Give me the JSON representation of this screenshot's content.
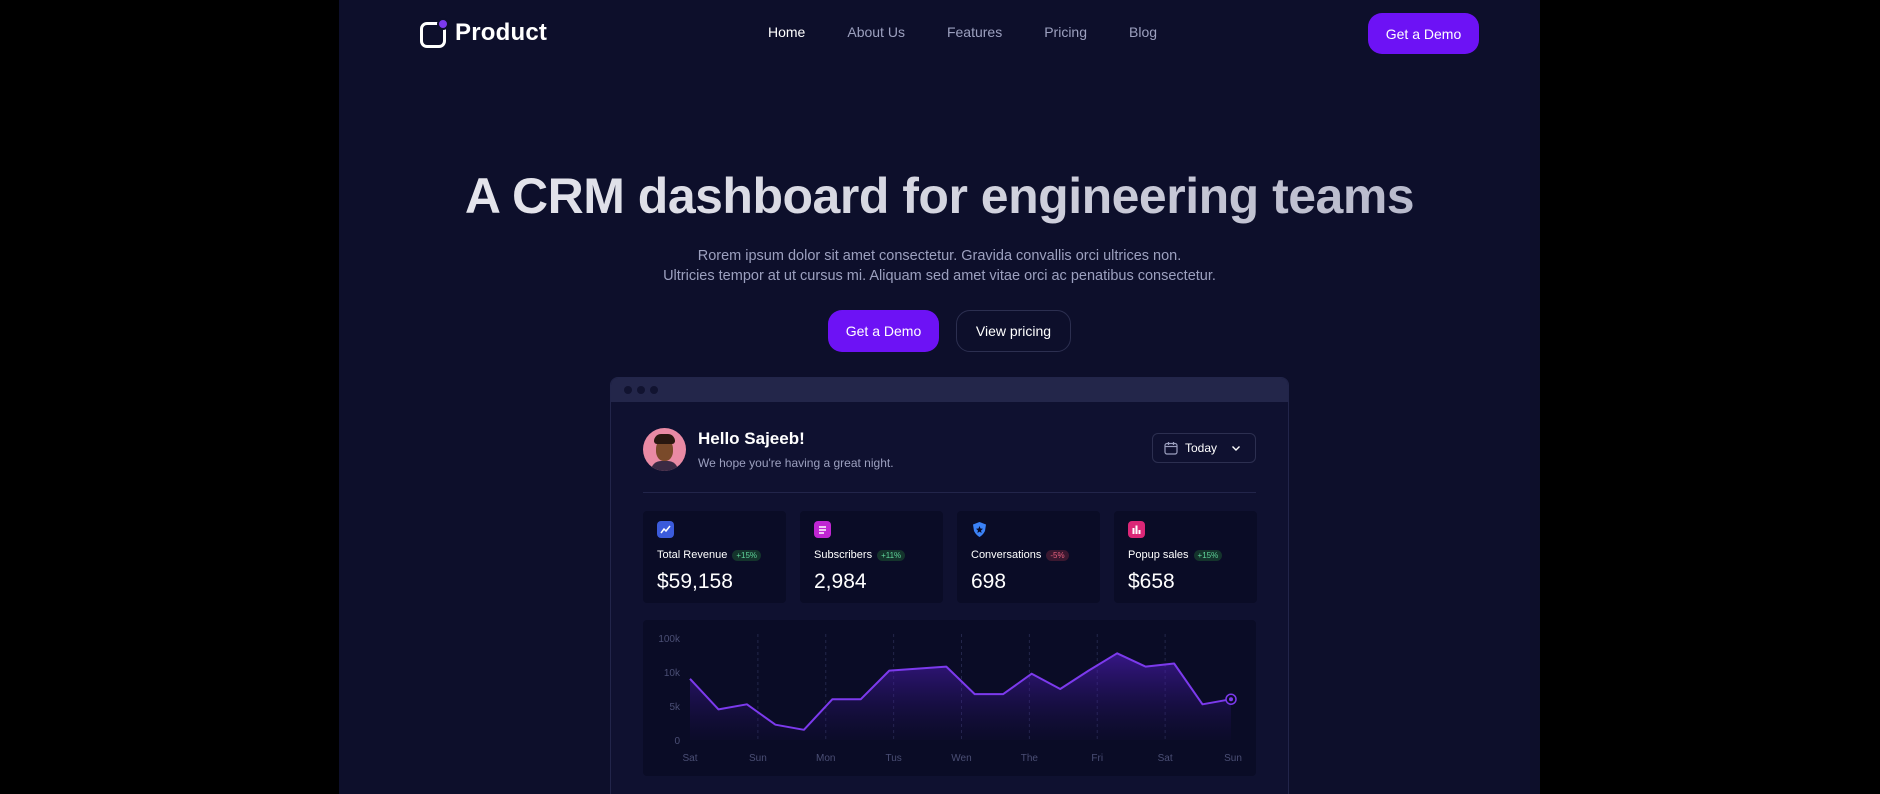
{
  "nav": {
    "logo_text": "Product",
    "links": [
      "Home",
      "About Us",
      "Features",
      "Pricing",
      "Blog"
    ],
    "active": "Home",
    "cta": "Get a Demo"
  },
  "hero": {
    "title": "A CRM dashboard for engineering teams",
    "sub_line1": "Rorem ipsum dolor sit amet consectetur. Gravida convallis orci ultrices non.",
    "sub_line2": "Ultricies tempor at ut cursus mi. Aliquam sed amet vitae orci ac penatibus consectetur.",
    "primary_btn": "Get a Demo",
    "secondary_btn": "View pricing"
  },
  "dashboard": {
    "greeting": "Hello Sajeeb!",
    "greeting_sub": "We hope you're having a great night.",
    "date_filter": "Today",
    "stats": [
      {
        "label": "Total Revenue",
        "badge": "+15%",
        "trend": "up",
        "value": "$59,158",
        "icon": "chart-up-icon",
        "color": "#3b5bdb"
      },
      {
        "label": "Subscribers",
        "badge": "+11%",
        "trend": "up",
        "value": "2,984",
        "icon": "list-icon",
        "color": "#c026d3"
      },
      {
        "label": "Conversations",
        "badge": "-5%",
        "trend": "down",
        "value": "698",
        "icon": "shield-star-icon",
        "color": "#3b82f6"
      },
      {
        "label": "Popup sales",
        "badge": "+15%",
        "trend": "up",
        "value": "$658",
        "icon": "bar-chart-icon",
        "color": "#db2777"
      }
    ]
  },
  "chart_data": {
    "type": "area",
    "y_tick_labels": [
      "100k",
      "10k",
      "5k",
      "0"
    ],
    "x_tick_labels": [
      "Sat",
      "Sun",
      "Mon",
      "Tus",
      "Wen",
      "The",
      "Fri",
      "Sat",
      "Sun"
    ],
    "series": [
      {
        "values": [
          6.0,
          3.0,
          3.5,
          1.5,
          1.0,
          4.0,
          4.0,
          6.8,
          7.0,
          7.2,
          4.5,
          4.5,
          6.5,
          5.0,
          6.8,
          8.5,
          7.2,
          7.5,
          3.5,
          4.0
        ]
      }
    ],
    "y_scale": "custom, tick labels 0 / 5k / 10k / 100k",
    "grid": "vertical dashed",
    "line_color": "#7c3aed"
  }
}
